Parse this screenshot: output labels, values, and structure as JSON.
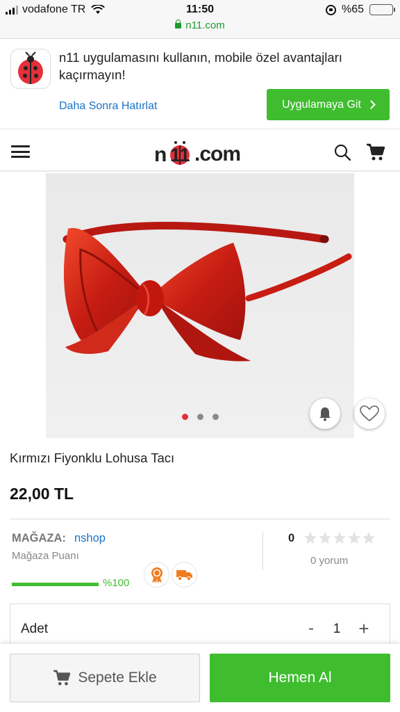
{
  "status_bar": {
    "carrier": "vodafone TR",
    "time": "11:50",
    "url": "n11.com",
    "battery": "%65",
    "battery_level": 0.65
  },
  "app_banner": {
    "message": "n11 uygulamasını kullanın, mobile özel avantajları kaçırmayın!",
    "remind_later": "Daha Sonra Hatırlat",
    "go_to_app": "Uygulamaya Git"
  },
  "header": {
    "logo": ".com"
  },
  "gallery": {
    "image_count": 3,
    "active_index": 0
  },
  "product": {
    "title": "Kırmızı Fiyonklu Lohusa Tacı",
    "price": "22,00 TL"
  },
  "store": {
    "label": "MAĞAZA:",
    "name": "nshop",
    "rating_label": "Mağaza Puanı",
    "score_percent": 100,
    "score_text": "%100"
  },
  "reviews": {
    "rating": "0",
    "stars": 0,
    "max_stars": 5,
    "count_text": "0 yorum"
  },
  "quantity": {
    "label": "Adet",
    "minus": "-",
    "value": "1",
    "plus": "+"
  },
  "actions": {
    "add_to_cart": "Sepete Ekle",
    "buy_now": "Hemen Al"
  },
  "colors": {
    "brand_green": "#3fbd2f",
    "link_blue": "#1a73c8",
    "brand_red": "#e3303a",
    "badge_orange": "#f07c1e"
  }
}
